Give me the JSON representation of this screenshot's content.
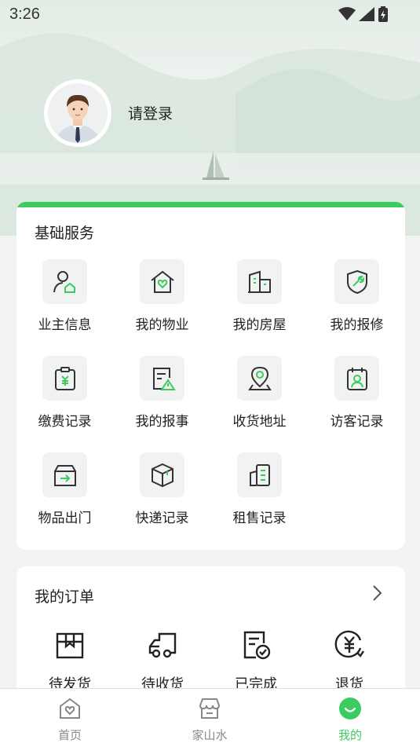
{
  "status_bar": {
    "time": "3:26"
  },
  "profile": {
    "login_prompt": "请登录"
  },
  "services": {
    "title": "基础服务",
    "items": [
      {
        "label": "业主信息",
        "icon": "owner-info-icon"
      },
      {
        "label": "我的物业",
        "icon": "property-home-icon"
      },
      {
        "label": "我的房屋",
        "icon": "building-icon"
      },
      {
        "label": "我的报修",
        "icon": "repair-shield-icon"
      },
      {
        "label": "缴费记录",
        "icon": "payment-record-icon"
      },
      {
        "label": "我的报事",
        "icon": "report-alert-icon"
      },
      {
        "label": "收货地址",
        "icon": "location-pin-icon"
      },
      {
        "label": "访客记录",
        "icon": "visitor-badge-icon"
      },
      {
        "label": "物品出门",
        "icon": "item-exit-box-icon"
      },
      {
        "label": "快递记录",
        "icon": "parcel-box-icon"
      },
      {
        "label": "租售记录",
        "icon": "rent-sale-icon"
      }
    ]
  },
  "orders": {
    "title": "我的订单",
    "items": [
      {
        "label": "待发货",
        "icon": "pending-ship-icon"
      },
      {
        "label": "待收货",
        "icon": "truck-icon"
      },
      {
        "label": "已完成",
        "icon": "completed-doc-icon"
      },
      {
        "label": "退货",
        "icon": "refund-yen-icon"
      }
    ]
  },
  "tabbar": {
    "tabs": [
      {
        "label": "首页",
        "icon": "home-heart-icon",
        "active": false
      },
      {
        "label": "家山水",
        "icon": "store-icon",
        "active": false
      },
      {
        "label": "我的",
        "icon": "smile-profile-icon",
        "active": true
      }
    ]
  },
  "colors": {
    "accent": "#3ccb5e",
    "tile_bg": "#f1f2f2",
    "text": "#222222"
  }
}
